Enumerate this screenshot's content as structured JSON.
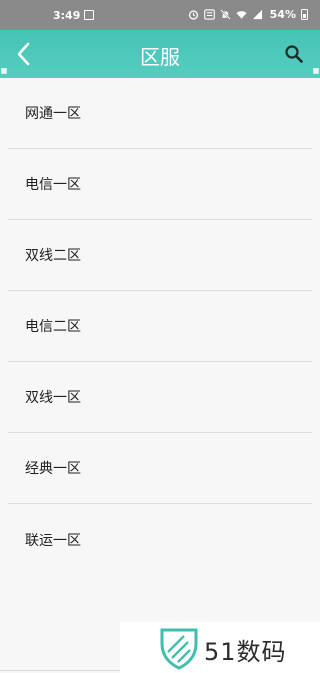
{
  "status_bar": {
    "time": "3:49",
    "battery_percent": "54%",
    "network": "4G"
  },
  "header": {
    "title": "区服",
    "back_icon": "chevron-left-icon",
    "search_icon": "search-icon"
  },
  "servers": [
    {
      "label": "网通一区"
    },
    {
      "label": "电信一区"
    },
    {
      "label": "双线二区"
    },
    {
      "label": "电信二区"
    },
    {
      "label": "双线一区"
    },
    {
      "label": "经典一区"
    },
    {
      "label": "联运一区"
    }
  ],
  "watermark": {
    "text": "51数码"
  },
  "colors": {
    "accent": "#4cc8ba",
    "status_bar": "#8a8a8a",
    "background": "#f7f7f7"
  }
}
